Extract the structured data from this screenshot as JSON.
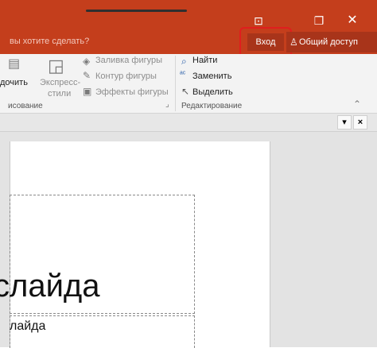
{
  "titlebar": {
    "tell_me": "вы хотите сделать?",
    "signin": "Вход",
    "share": "Общий доступ",
    "restore_icon": "ribbon-display-icon",
    "maximize_icon": "restore-icon",
    "close_icon": "close-icon"
  },
  "ribbon": {
    "drawing": {
      "arrange_partial": "дочить",
      "quick_styles_line1": "Экспресс-",
      "quick_styles_line2": "стили",
      "shape_fill": "Заливка фигуры",
      "shape_outline": "Контур фигуры",
      "shape_effects": "Эффекты фигуры",
      "group_label": "исование"
    },
    "editing": {
      "find": "Найти",
      "replace": "Заменить",
      "select": "Выделить",
      "group_label": "Редактирование"
    }
  },
  "pane": {
    "dropdown": "▾",
    "close": "×"
  },
  "slide": {
    "title": "слайда",
    "subtitle": "лайда"
  }
}
